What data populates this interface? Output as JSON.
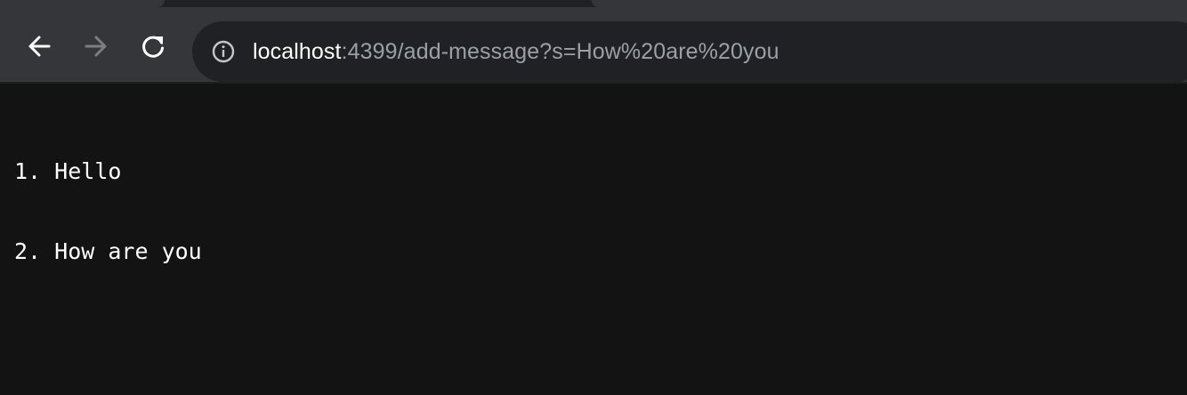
{
  "toolbar": {
    "back_icon": "arrow-left-icon",
    "forward_icon": "arrow-right-icon",
    "reload_icon": "reload-icon",
    "site_info_icon": "info-icon",
    "url_host": "localhost",
    "url_rest": ":4399/add-message?s=How%20are%20you"
  },
  "messages": [
    {
      "number": "1.",
      "text": "Hello"
    },
    {
      "number": "2.",
      "text": "How are you"
    }
  ],
  "colors": {
    "page_background": "#131313",
    "toolbar_background": "#35363a",
    "omnibox_background": "#202124",
    "url_dim": "#9aa0a6",
    "forward_disabled": "#7d7e80"
  }
}
